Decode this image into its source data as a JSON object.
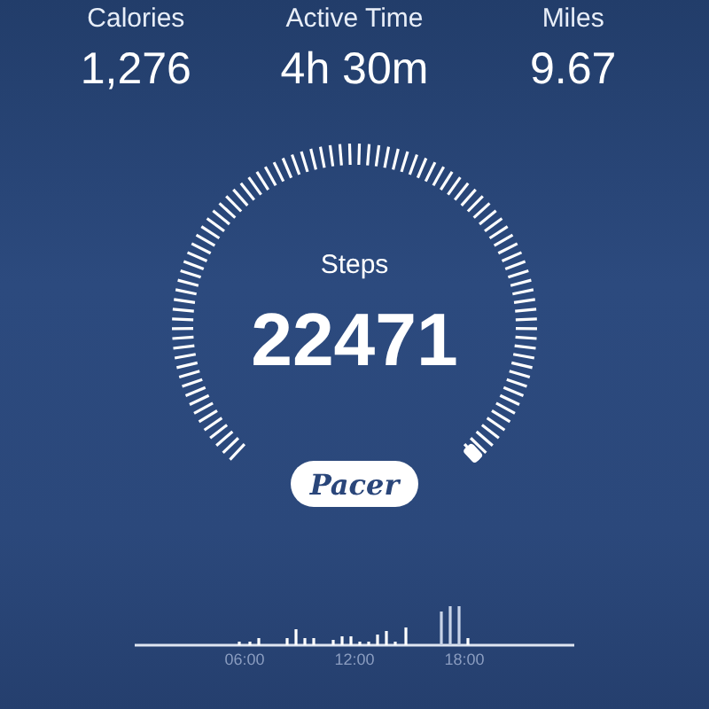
{
  "stats": [
    {
      "label": "Calories",
      "value": "1,276"
    },
    {
      "label": "Active Time",
      "value": "4h 30m"
    },
    {
      "label": "Miles",
      "value": "9.67"
    }
  ],
  "gauge": {
    "label": "Steps",
    "value": "22471"
  },
  "logo": {
    "text": "Pacer"
  },
  "chart": {
    "axis_labels": [
      "06:00",
      "12:00",
      "18:00"
    ]
  }
}
